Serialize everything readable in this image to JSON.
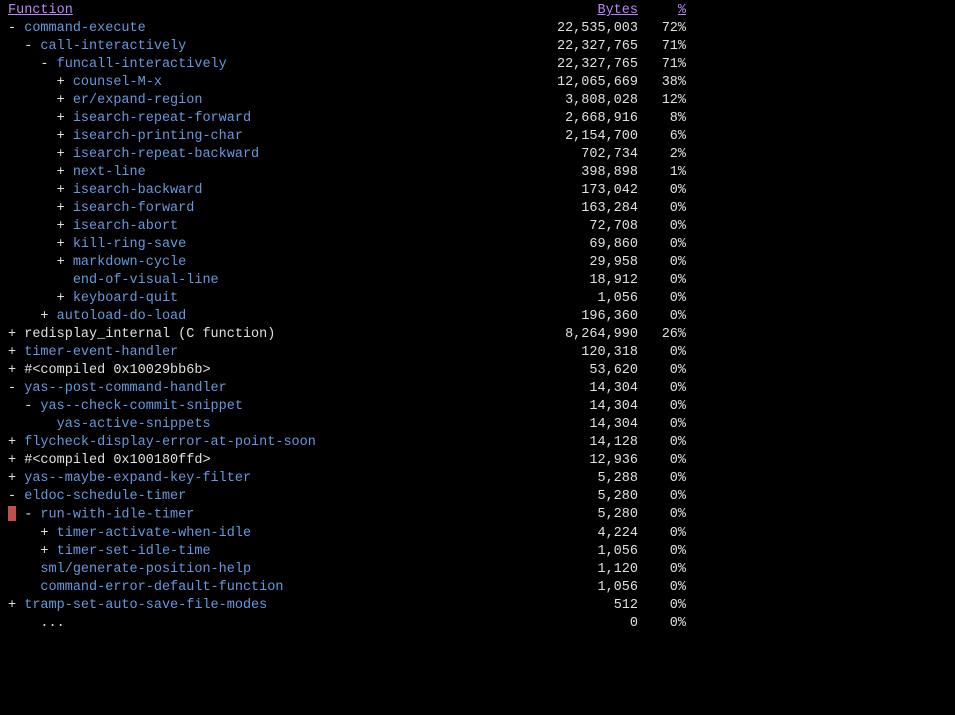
{
  "header": {
    "function": "Function",
    "bytes": "Bytes",
    "percent": "%"
  },
  "rows": [
    {
      "indent": 0,
      "toggle": "-",
      "link": true,
      "cursor": false,
      "name": "command-execute",
      "bytes": "22,535,003",
      "pct": "72%"
    },
    {
      "indent": 1,
      "toggle": "-",
      "link": true,
      "cursor": false,
      "name": "call-interactively",
      "bytes": "22,327,765",
      "pct": "71%"
    },
    {
      "indent": 2,
      "toggle": "-",
      "link": true,
      "cursor": false,
      "name": "funcall-interactively",
      "bytes": "22,327,765",
      "pct": "71%"
    },
    {
      "indent": 3,
      "toggle": "+",
      "link": true,
      "cursor": false,
      "name": "counsel-M-x",
      "bytes": "12,065,669",
      "pct": "38%"
    },
    {
      "indent": 3,
      "toggle": "+",
      "link": true,
      "cursor": false,
      "name": "er/expand-region",
      "bytes": "3,808,028",
      "pct": "12%"
    },
    {
      "indent": 3,
      "toggle": "+",
      "link": true,
      "cursor": false,
      "name": "isearch-repeat-forward",
      "bytes": "2,668,916",
      "pct": "8%"
    },
    {
      "indent": 3,
      "toggle": "+",
      "link": true,
      "cursor": false,
      "name": "isearch-printing-char",
      "bytes": "2,154,700",
      "pct": "6%"
    },
    {
      "indent": 3,
      "toggle": "+",
      "link": true,
      "cursor": false,
      "name": "isearch-repeat-backward",
      "bytes": "702,734",
      "pct": "2%"
    },
    {
      "indent": 3,
      "toggle": "+",
      "link": true,
      "cursor": false,
      "name": "next-line",
      "bytes": "398,898",
      "pct": "1%"
    },
    {
      "indent": 3,
      "toggle": "+",
      "link": true,
      "cursor": false,
      "name": "isearch-backward",
      "bytes": "173,042",
      "pct": "0%"
    },
    {
      "indent": 3,
      "toggle": "+",
      "link": true,
      "cursor": false,
      "name": "isearch-forward",
      "bytes": "163,284",
      "pct": "0%"
    },
    {
      "indent": 3,
      "toggle": "+",
      "link": true,
      "cursor": false,
      "name": "isearch-abort",
      "bytes": "72,708",
      "pct": "0%"
    },
    {
      "indent": 3,
      "toggle": "+",
      "link": true,
      "cursor": false,
      "name": "kill-ring-save",
      "bytes": "69,860",
      "pct": "0%"
    },
    {
      "indent": 3,
      "toggle": "+",
      "link": true,
      "cursor": false,
      "name": "markdown-cycle",
      "bytes": "29,958",
      "pct": "0%"
    },
    {
      "indent": 3,
      "toggle": " ",
      "link": true,
      "cursor": false,
      "name": "end-of-visual-line",
      "bytes": "18,912",
      "pct": "0%"
    },
    {
      "indent": 3,
      "toggle": "+",
      "link": true,
      "cursor": false,
      "name": "keyboard-quit",
      "bytes": "1,056",
      "pct": "0%"
    },
    {
      "indent": 2,
      "toggle": "+",
      "link": true,
      "cursor": false,
      "name": "autoload-do-load",
      "bytes": "196,360",
      "pct": "0%"
    },
    {
      "indent": 0,
      "toggle": "+",
      "link": false,
      "cursor": false,
      "name": "redisplay_internal (C function)",
      "bytes": "8,264,990",
      "pct": "26%"
    },
    {
      "indent": 0,
      "toggle": "+",
      "link": true,
      "cursor": false,
      "name": "timer-event-handler",
      "bytes": "120,318",
      "pct": "0%"
    },
    {
      "indent": 0,
      "toggle": "+",
      "link": false,
      "cursor": false,
      "name": "#<compiled 0x10029bb6b>",
      "bytes": "53,620",
      "pct": "0%"
    },
    {
      "indent": 0,
      "toggle": "-",
      "link": true,
      "cursor": false,
      "name": "yas--post-command-handler",
      "bytes": "14,304",
      "pct": "0%"
    },
    {
      "indent": 1,
      "toggle": "-",
      "link": true,
      "cursor": false,
      "name": "yas--check-commit-snippet",
      "bytes": "14,304",
      "pct": "0%"
    },
    {
      "indent": 2,
      "toggle": " ",
      "link": true,
      "cursor": false,
      "name": "yas-active-snippets",
      "bytes": "14,304",
      "pct": "0%"
    },
    {
      "indent": 0,
      "toggle": "+",
      "link": true,
      "cursor": false,
      "name": "flycheck-display-error-at-point-soon",
      "bytes": "14,128",
      "pct": "0%"
    },
    {
      "indent": 0,
      "toggle": "+",
      "link": false,
      "cursor": false,
      "name": "#<compiled 0x100180ffd>",
      "bytes": "12,936",
      "pct": "0%"
    },
    {
      "indent": 0,
      "toggle": "+",
      "link": true,
      "cursor": false,
      "name": "yas--maybe-expand-key-filter",
      "bytes": "5,288",
      "pct": "0%"
    },
    {
      "indent": 0,
      "toggle": "-",
      "link": true,
      "cursor": false,
      "name": "eldoc-schedule-timer",
      "bytes": "5,280",
      "pct": "0%"
    },
    {
      "indent": 1,
      "toggle": "-",
      "link": true,
      "cursor": true,
      "name": "run-with-idle-timer",
      "bytes": "5,280",
      "pct": "0%"
    },
    {
      "indent": 2,
      "toggle": "+",
      "link": true,
      "cursor": false,
      "name": "timer-activate-when-idle",
      "bytes": "4,224",
      "pct": "0%"
    },
    {
      "indent": 2,
      "toggle": "+",
      "link": true,
      "cursor": false,
      "name": "timer-set-idle-time",
      "bytes": "1,056",
      "pct": "0%"
    },
    {
      "indent": 1,
      "toggle": " ",
      "link": true,
      "cursor": false,
      "name": "sml/generate-position-help",
      "bytes": "1,120",
      "pct": "0%"
    },
    {
      "indent": 1,
      "toggle": " ",
      "link": true,
      "cursor": false,
      "name": "command-error-default-function",
      "bytes": "1,056",
      "pct": "0%"
    },
    {
      "indent": 0,
      "toggle": "+",
      "link": true,
      "cursor": false,
      "name": "tramp-set-auto-save-file-modes",
      "bytes": "512",
      "pct": "0%"
    },
    {
      "indent": 1,
      "toggle": " ",
      "link": false,
      "cursor": false,
      "name": "...",
      "bytes": "0",
      "pct": "0%"
    }
  ]
}
